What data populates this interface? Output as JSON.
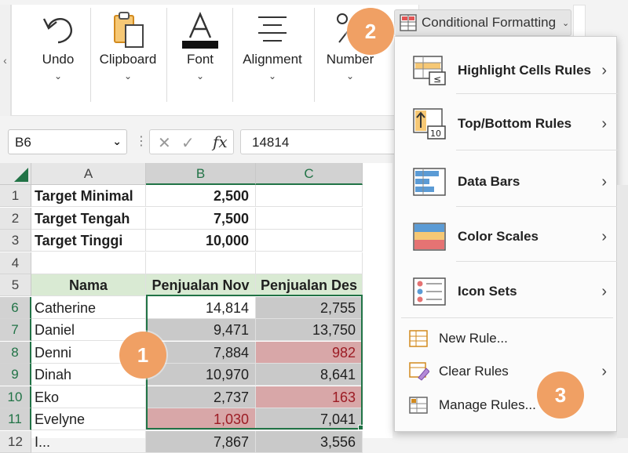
{
  "ribbon": {
    "scroll_left": "‹",
    "groups": [
      {
        "label": "Undo"
      },
      {
        "label": "Clipboard"
      },
      {
        "label": "Font"
      },
      {
        "label": "Alignment"
      },
      {
        "label": "Number"
      }
    ],
    "conditional_formatting": "Conditional Formatting"
  },
  "formula_bar": {
    "name_box": "B6",
    "formula": "14814"
  },
  "grid": {
    "columns": [
      "A",
      "B",
      "C"
    ],
    "rows": [
      "1",
      "2",
      "3",
      "4",
      "5",
      "6",
      "7",
      "8",
      "9",
      "10",
      "11",
      "12"
    ],
    "targets": [
      {
        "label": "Target Minimal",
        "value": "2,500"
      },
      {
        "label": "Target Tengah",
        "value": "7,500"
      },
      {
        "label": "Target Tinggi",
        "value": "10,000"
      }
    ],
    "headers": {
      "name": "Nama",
      "nov": "Penjualan Nov",
      "des": "Penjualan Des"
    },
    "data": [
      {
        "name": "Catherine",
        "nov": "14,814",
        "des": "2,755"
      },
      {
        "name": "Daniel",
        "nov": "9,471",
        "des": "13,750"
      },
      {
        "name": "Denni",
        "nov": "7,884",
        "des": "982"
      },
      {
        "name": "Dinah",
        "nov": "10,970",
        "des": "8,641"
      },
      {
        "name": "Eko",
        "nov": "2,737",
        "des": "163"
      },
      {
        "name": "Evelyne",
        "nov": "1,030",
        "des": "7,041"
      },
      {
        "name": "I...",
        "nov": "7,867",
        "des": "3,556"
      }
    ]
  },
  "menu": {
    "highlight": "Highlight Cells Rules",
    "topbottom": "Top/Bottom Rules",
    "databars": "Data Bars",
    "colorscales": "Color Scales",
    "iconsets": "Icon Sets",
    "newrule": "New Rule...",
    "clearrules": "Clear Rules",
    "managerules": "Manage Rules..."
  },
  "badges": {
    "one": "1",
    "two": "2",
    "three": "3"
  },
  "colors": {
    "accent": "#217346",
    "badge": "#f0a064",
    "red_fill": "#d8a7a8",
    "grey_fill": "#c9c9c9",
    "header_fill": "#d9ead3"
  }
}
